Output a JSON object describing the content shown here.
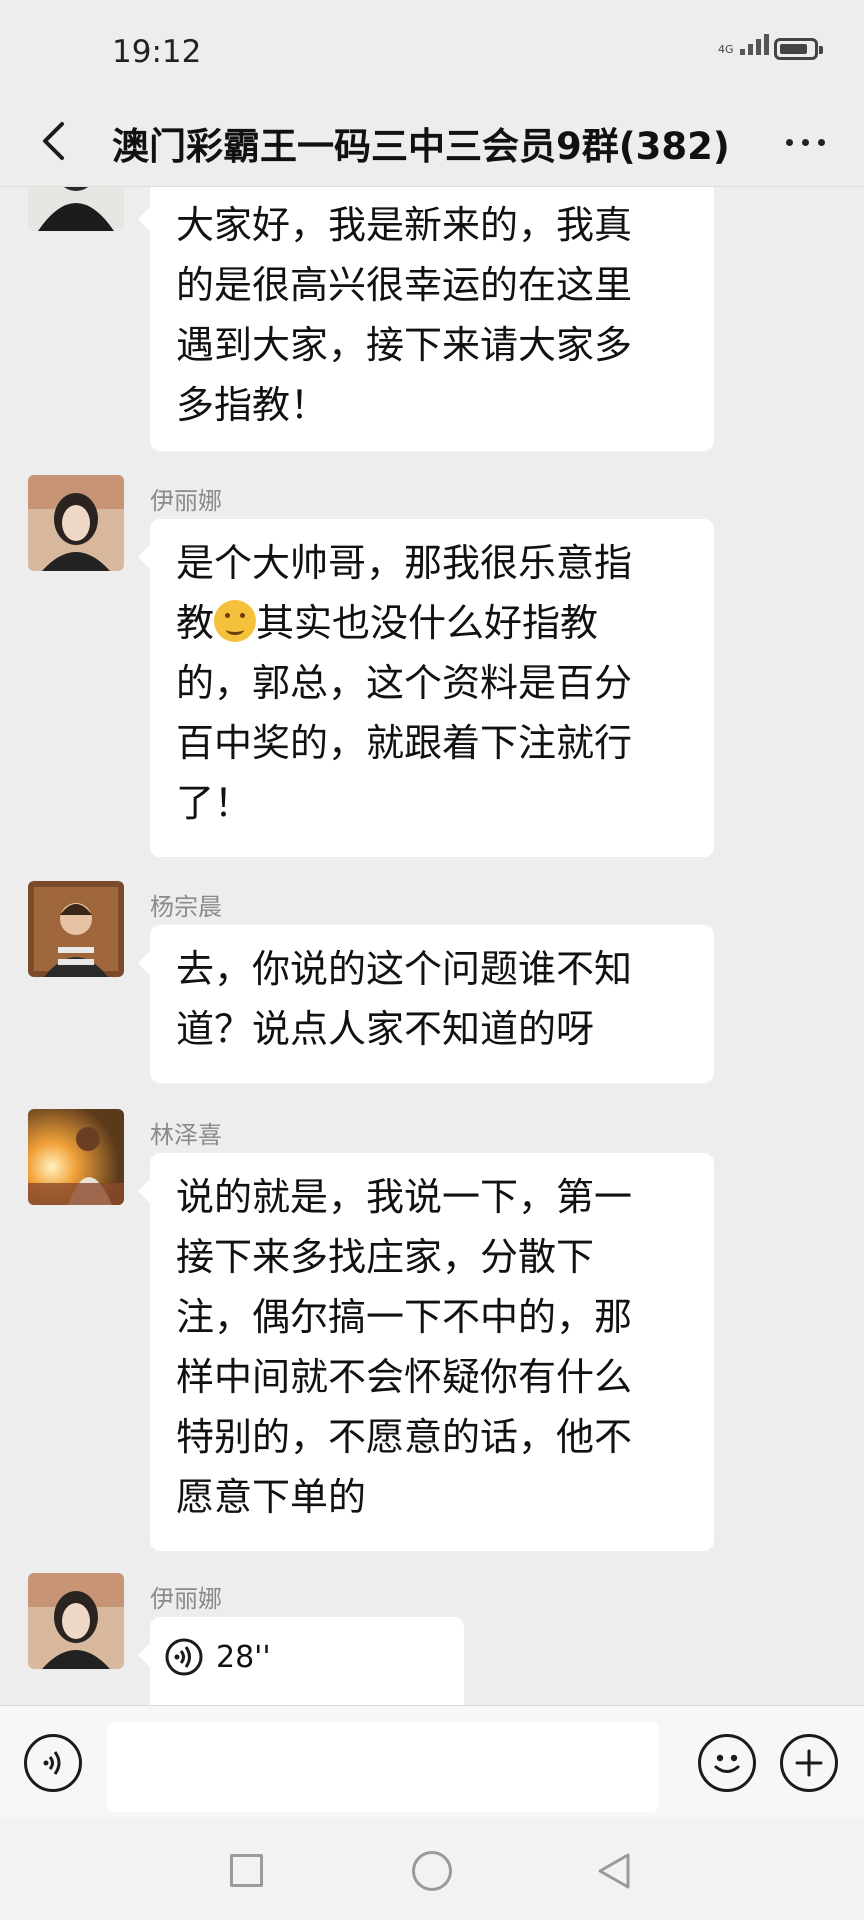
{
  "status_bar": {
    "time": "19:12",
    "network": "4G",
    "signal_bars": 4,
    "battery_level": 0.85
  },
  "header": {
    "title": "澳门彩霸王一码三中三会员9群(382)"
  },
  "colors": {
    "background": "#ededed",
    "bubble": "#ffffff",
    "sender_name": "#8a8a8a",
    "text": "#111111"
  },
  "messages": [
    {
      "sender": "",
      "text": "大家好，我是新来的，我真\n的是很高兴很幸运的在这里\n遇到大家，接下来请大家多\n多指教！"
    },
    {
      "sender": "伊丽娜",
      "text_before_emoji": "是个大帅哥，那我很乐意指\n教",
      "emoji": "thinking-face",
      "text_after_emoji": "其实也没什么好指教\n的，郭总，这个资料是百分\n百中奖的，就跟着下注就行\n了！"
    },
    {
      "sender": "杨宗晨",
      "text": "去，你说的这个问题谁不知\n道？说点人家不知道的呀"
    },
    {
      "sender": "林泽喜",
      "text": "说的就是，我说一下，第一\n接下来多找庄家，分散下\n注，偶尔搞一下不中的，那\n样中间就不会怀疑你有什么\n特别的，不愿意的话，他不\n愿意下单的"
    },
    {
      "sender": "伊丽娜",
      "type": "voice",
      "duration": "28''"
    }
  ],
  "input_bar": {
    "placeholder": "",
    "value": ""
  },
  "icons": {
    "back": "chevron-left-icon",
    "more": "more-dots-icon",
    "voice_mode": "voice-mode-icon",
    "emoji": "smiley-icon",
    "add": "plus-icon",
    "nav_recents": "square-icon",
    "nav_home": "circle-icon",
    "nav_back": "triangle-back-icon"
  }
}
